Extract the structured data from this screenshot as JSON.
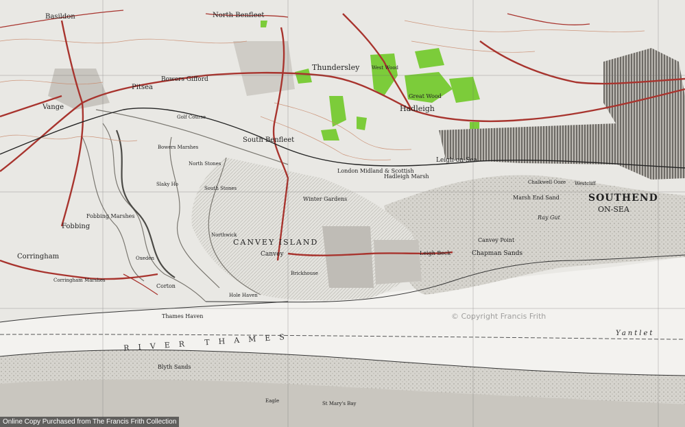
{
  "map": {
    "watermark": "© Copyright Francis Frith",
    "credit": "Online Copy Purchased from The Francis Frith Collection",
    "colors": {
      "land": "#e9e8e4",
      "water": "#f3f2ef",
      "mud": "#cfcdc7",
      "roads": "#a8342e",
      "woods": "#7ccc3a",
      "grid": "#666666"
    },
    "labels": {
      "basildon": "Basildon",
      "north_benfleet": "North Benfleet",
      "thundersley": "Thundersley",
      "bowers_gifford": "Bowers Gifford",
      "pitsea": "Pitsea",
      "vange": "Vange",
      "south_benfleet": "South Benfleet",
      "hadleigh": "Hadleigh",
      "great_wood": "Great Wood",
      "west_wood": "West Wood",
      "leigh_on_sea": "Leigh-on-Sea",
      "southend": "SOUTHEND",
      "on_sea": "ON-SEA",
      "hadleigh_marsh": "Hadleigh Marsh",
      "railway": "London Midland & Scottish",
      "chalkwell_ooze": "Chalkwell Ooze",
      "westcliff": "Westcliff",
      "marsh_end_sand": "Marsh End Sand",
      "ray_gut": "Ray Gut",
      "canvey_point": "Canvey Point",
      "chapman_sands": "Chapman Sands",
      "leigh_beck": "Leigh Beck",
      "winter_gardens": "Winter Gardens",
      "canvey_island": "CANVEY ISLAND",
      "canvey": "Canvey",
      "fobbing": "Fobbing",
      "fobbing_marshes": "Fobbing Marshes",
      "corringham": "Corringham",
      "corringham_marshes": "Corringham Marshes",
      "corton": "Corton",
      "thames_haven": "Thames Haven",
      "river_thames": "RIVER THAMES",
      "yantlet": "Yantlet",
      "blyth_sands": "Blyth Sands",
      "golf_course": "Golf Course",
      "bowers_marshes": "Bowers Marshes",
      "north_stones": "North Stones",
      "slaky_ho": "Slaky Ho",
      "south_stones": "South Stones",
      "hole_haven": "Hole Haven",
      "brickhouse": "Brickhouse",
      "northwick": "Northwick",
      "oxeden": "Oxeden",
      "eagle": "Eagle",
      "st_marys_bay": "St Mary's Bay"
    }
  }
}
